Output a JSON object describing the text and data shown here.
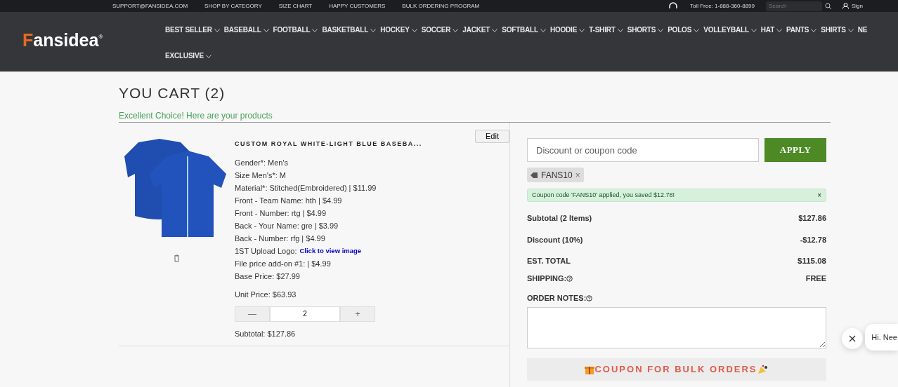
{
  "top_bar": {
    "links": [
      "SUPPORT@FANSIDEA.COM",
      "SHOP BY CATEGORY",
      "SIZE CHART",
      "HAPPY CUSTOMERS",
      "BULK ORDERING PROGRAM"
    ],
    "phone": "Toll Free: 1-888-360-8899",
    "search": {
      "placeholder": "Search"
    },
    "account": "Sign"
  },
  "header": {
    "logo": "Fansidea",
    "logo_mark": "®",
    "menu": [
      "BEST SELLER",
      "BASEBALL",
      "FOOTBALL",
      "BASKETBALL",
      "HOCKEY",
      "SOCCER",
      "JACKET",
      "SOFTBALL",
      "HOODIE",
      "T-SHIRT",
      "SHORTS",
      "POLOS",
      "VOLLEYBALL",
      "HAT",
      "PANTS",
      "SHIRTS",
      "NE",
      "EXCLUSIVE"
    ]
  },
  "cart": {
    "title": "YOU CART (2)",
    "subtitle": "Excellent Choice! Here are your products",
    "items": [
      {
        "name": "CUSTOM ROYAL WHITE-LIGHT BLUE BASEBA...",
        "edit": "Edit",
        "options": [
          {
            "kind": "text",
            "text": "Gender*: Men's"
          },
          {
            "kind": "text",
            "text": "Size Men's*: M"
          },
          {
            "kind": "text",
            "text": "Material*: Stitched(Embroidered) | $11.99"
          },
          {
            "kind": "text",
            "text": "Front - Team Name: hth | $4.99"
          },
          {
            "kind": "text",
            "text": "Front - Number: rtg | $4.99"
          },
          {
            "kind": "text",
            "text": "Back - Your Name: gre | $3.99"
          },
          {
            "kind": "text",
            "text": "Back - Number: rfg | $4.99"
          },
          {
            "kind": "link",
            "text": "1ST Upload Logo:",
            "link": "Click to view image"
          },
          {
            "kind": "text",
            "text": "File price add-on #1: | $4.99"
          },
          {
            "kind": "text",
            "text": "Base Price: $27.99"
          }
        ],
        "unit_price": "Unit Price: $63.93",
        "minus": "—",
        "quantity": "2",
        "plus": "+",
        "subtotal": "Subtotal: $127.86"
      }
    ]
  },
  "summary": {
    "coupon": {
      "placeholder": "Discount or coupon code"
    },
    "apply": "APPLY",
    "applied_coupons": [
      {
        "code": "FANS10",
        "remove": "×"
      }
    ],
    "alert": {
      "text": "Coupon code 'FANS10' applied, you saved $12.78!",
      "close": "×"
    },
    "rows": [
      {
        "kind": "line",
        "label": "Subtotal (2 Items)",
        "value": "$127.86"
      },
      {
        "kind": "line",
        "label": "Discount (10%)",
        "value": "-$12.78"
      },
      {
        "kind": "total",
        "label": "EST. TOTAL",
        "value": "$115.08"
      },
      {
        "kind": "help",
        "label": "SHIPPING:",
        "value": "FREE"
      }
    ],
    "notes_label": "ORDER NOTES:",
    "bulk_title": "COUPON FOR BULK ORDERS"
  },
  "chat": {
    "message": "Hi. Nee"
  }
}
